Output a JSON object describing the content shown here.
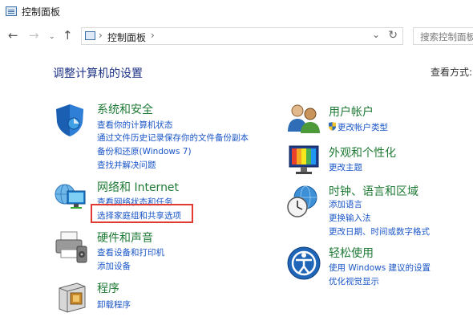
{
  "window": {
    "title": "控制面板"
  },
  "nav": {
    "back_icon": "back-arrow-icon",
    "forward_icon": "forward-arrow-icon",
    "recent_icon": "chevron-down-icon",
    "up_icon": "up-arrow-icon",
    "breadcrumb": "控制面板",
    "search_placeholder": "搜索控制面板"
  },
  "main": {
    "heading": "调整计算机的设置",
    "view_by": "查看方式:",
    "highlight_color": "#e23a31",
    "link_color": "#1a56c8",
    "category_color": "#1e7a34"
  },
  "categories": [
    {
      "id": "system-security",
      "title": "系统和安全",
      "icon": "shield-icon",
      "links": [
        "查看你的计算机状态",
        "通过文件历史记录保存你的文件备份副本",
        "备份和还原(Windows 7)",
        "查找并解决问题"
      ]
    },
    {
      "id": "network-internet",
      "title": "网络和 Internet",
      "icon": "network-globe-icon",
      "links": [
        "查看网络状态和任务",
        "选择家庭组和共享选项"
      ]
    },
    {
      "id": "hardware-sound",
      "title": "硬件和声音",
      "icon": "printer-icon",
      "links": [
        "查看设备和打印机",
        "添加设备"
      ]
    },
    {
      "id": "programs",
      "title": "程序",
      "icon": "program-box-icon",
      "links": [
        "卸载程序"
      ]
    },
    {
      "id": "user-accounts",
      "title": "用户帐户",
      "icon": "users-icon",
      "links": [
        "更改帐户类型"
      ]
    },
    {
      "id": "appearance",
      "title": "外观和个性化",
      "icon": "monitor-icon",
      "links": [
        "更改主题"
      ]
    },
    {
      "id": "clock-region",
      "title": "时钟、语言和区域",
      "icon": "clock-globe-icon",
      "links": [
        "添加语言",
        "更换输入法",
        "更改日期、时间或数字格式"
      ]
    },
    {
      "id": "ease-of-access",
      "title": "轻松使用",
      "icon": "ease-of-access-icon",
      "links": [
        "使用 Windows 建议的设置",
        "优化视觉显示"
      ]
    }
  ]
}
